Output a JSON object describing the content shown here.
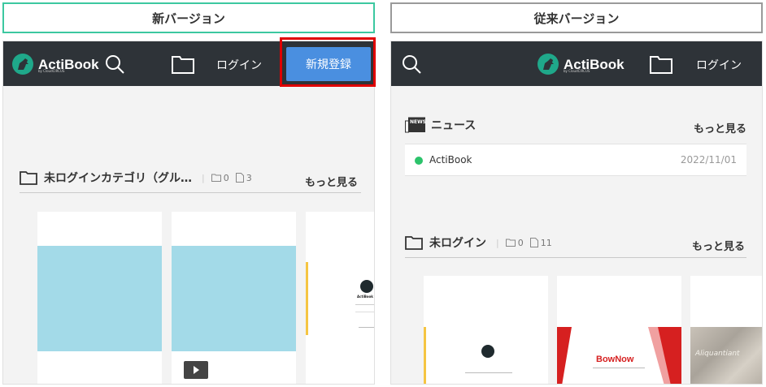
{
  "new_version": {
    "label": "新バージョン",
    "label_border_color": "#3cc8a0",
    "navbar": {
      "logo_text": "ActiBook",
      "logo_sub": "by CloudCIRCUS",
      "login": "ログイン",
      "signup": "新規登録",
      "highlight_color": "#e00000"
    },
    "category": {
      "title": "未ログインカテゴリ（グル…",
      "folder_count": "0",
      "file_count": "3",
      "more": "もっと見る"
    },
    "cards": [
      {
        "type": "blank-blue"
      },
      {
        "type": "video"
      },
      {
        "type": "actibook-doc",
        "brand": "ActiBook"
      }
    ]
  },
  "old_version": {
    "label": "従来バージョン",
    "label_border_color": "#9a9a9a",
    "navbar": {
      "logo_text": "ActiBook",
      "logo_sub": "by CloudCIRCUS",
      "login": "ログイン"
    },
    "news": {
      "title": "ニュース",
      "badge": "NEWS",
      "more": "もっと見る",
      "item_title": "ActiBook",
      "item_date": "2022/11/01",
      "dot_color": "#2cc36b"
    },
    "category": {
      "title": "未ログイン",
      "folder_count": "0",
      "file_count": "11",
      "more": "もっと見る"
    },
    "cards": [
      {
        "type": "actibook-slide"
      },
      {
        "type": "bownow",
        "brand": "BowNow"
      },
      {
        "type": "photo",
        "caption": "Aliquantiant"
      }
    ]
  }
}
